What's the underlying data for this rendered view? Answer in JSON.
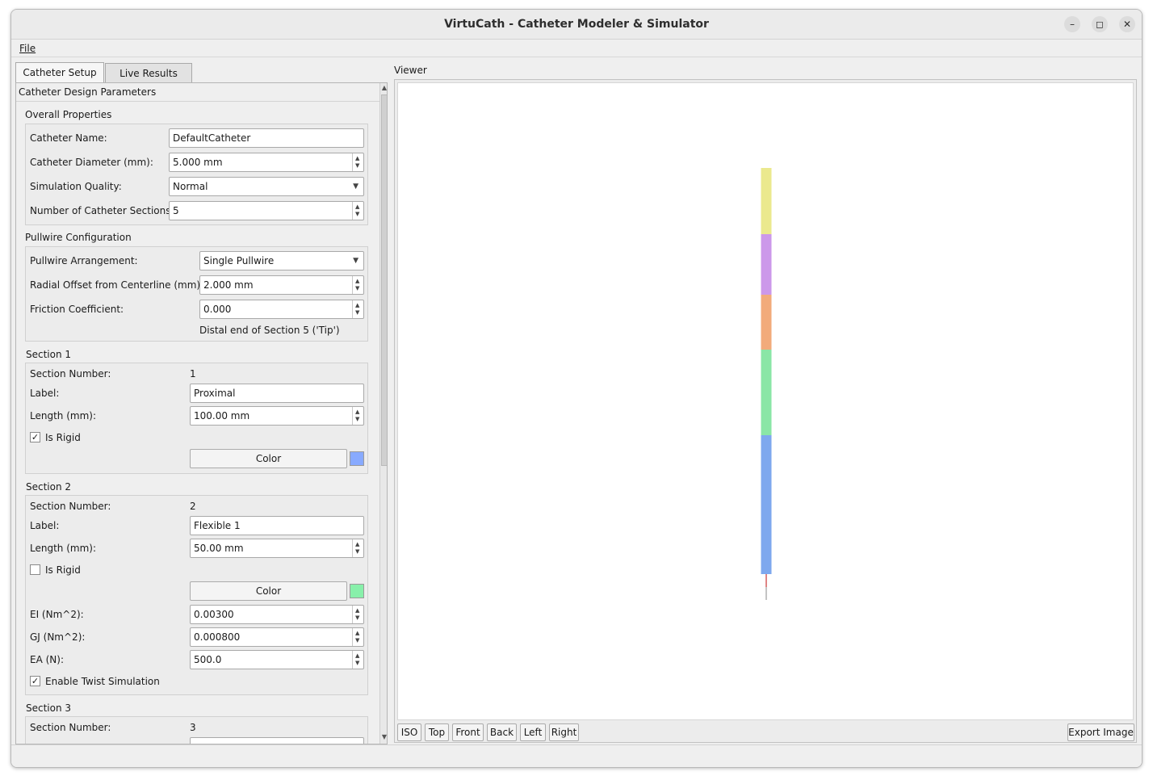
{
  "window": {
    "title": "VirtuCath - Catheter Modeler & Simulator"
  },
  "menu": {
    "file": "File"
  },
  "tabs": [
    {
      "label": "Catheter Setup"
    },
    {
      "label": "Live Results"
    }
  ],
  "setup": {
    "heading": "Catheter Design Parameters",
    "overall": {
      "title": "Overall Properties",
      "name_label": "Catheter Name:",
      "name_value": "DefaultCatheter",
      "diameter_label": "Catheter Diameter (mm):",
      "diameter_value": "5.000 mm",
      "quality_label": "Simulation Quality:",
      "quality_value": "Normal",
      "sections_label": "Number of Catheter Sections:",
      "sections_value": "5"
    },
    "pullwire": {
      "title": "Pullwire Configuration",
      "arrangement_label": "Pullwire Arrangement:",
      "arrangement_value": "Single Pullwire",
      "offset_label": "Radial Offset from Centerline (mm):",
      "offset_value": "2.000 mm",
      "friction_label": "Friction Coefficient:",
      "friction_value": "0.000",
      "note": "Distal end of Section 5 ('Tip')"
    },
    "section1": {
      "title": "Section 1",
      "number_label": "Section Number:",
      "number_value": "1",
      "label_label": "Label:",
      "label_value": "Proximal",
      "length_label": "Length (mm):",
      "length_value": "100.00 mm",
      "rigid_label": "Is Rigid",
      "rigid_checked": true,
      "color_button": "Color",
      "color": "#88aaff"
    },
    "section2": {
      "title": "Section 2",
      "number_label": "Section Number:",
      "number_value": "2",
      "label_label": "Label:",
      "label_value": "Flexible 1",
      "length_label": "Length (mm):",
      "length_value": "50.00 mm",
      "rigid_label": "Is Rigid",
      "rigid_checked": false,
      "color_button": "Color",
      "color": "#88f0aa",
      "ei_label": "EI (Nm^2):",
      "ei_value": "0.00300",
      "gj_label": "GJ (Nm^2):",
      "gj_value": "0.000800",
      "ea_label": "EA (N):",
      "ea_value": "500.0",
      "twist_label": "Enable Twist Simulation",
      "twist_checked": true
    },
    "section3": {
      "title": "Section 3",
      "number_label": "Section Number:",
      "number_value": "3"
    }
  },
  "viewer": {
    "label": "Viewer",
    "buttons": {
      "iso": "ISO",
      "top": "Top",
      "front": "Front",
      "back": "Back",
      "left": "Left",
      "right": "Right",
      "export": "Export Image"
    },
    "segment_colors": [
      "#ebe98e",
      "#cc98ea",
      "#f2ab7b",
      "#8ae6a6",
      "#7ea8ee"
    ],
    "pullwire_color": "#cc3333"
  }
}
